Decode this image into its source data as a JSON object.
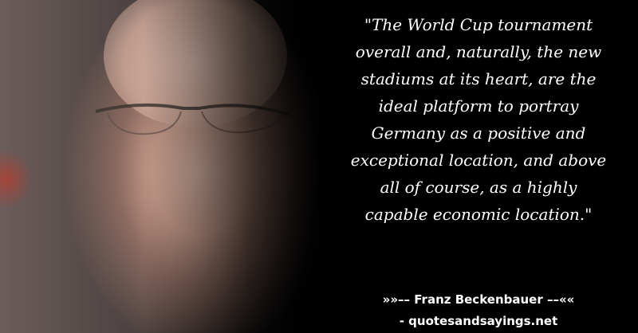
{
  "quote": {
    "text": "\"The World Cup tournament\noverall and, naturally, the new\nstadiums at its heart, are the\nideal platform to portray\nGermany as a positive and\nexceptional location, and above\nall of course, as a highly\ncapable economic location.\""
  },
  "author_line": "»»–– Franz Beckenbauer ––««",
  "site_line": "- quotesandsayings.net",
  "colors": {
    "background": "#000000",
    "text": "#ffffff"
  }
}
